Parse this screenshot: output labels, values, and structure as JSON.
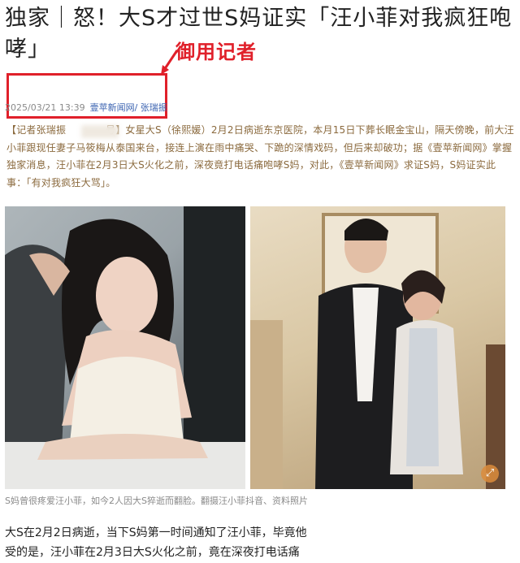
{
  "headline": "独家｜怒！大S才过世S妈证实「汪小菲对我疯狂咆哮」",
  "annotation": {
    "label": "御用记者",
    "color": "#e0202a"
  },
  "meta": {
    "date": "2025/03/21 13:39",
    "source": "壹苹新闻网/ 张瑞振"
  },
  "lead": "【记者张瑞振　　　　号】女星大S（徐熙媛）2月2日病逝东京医院，本月15日下葬长眠金宝山，隔天傍晚，前大汪小菲跟现任妻子马筱梅从泰国来台，接连上演在雨中痛哭、下跪的深情戏码，但后来却破功；据《壹苹新闻网》掌握独家消息，汪小菲在2月3日大S火化之前，深夜竟打电话痛咆哮S妈，对此，《壹苹新闻网》求证S妈，S妈证实此事：「有对我疯狂大骂」。",
  "caption": "S妈曾很疼爱汪小菲，如今2人因大S猝逝而翻脸。翻摄汪小菲抖音、资料照片",
  "body": {
    "line1": "大S在2月2日病逝，当下S妈第一时间通知了汪小菲，毕竟他",
    "line2": "受的是，汪小菲在2月3日大S火化之前，竟在深夜打电话痛"
  },
  "icons": {
    "expand": "expand-arrows-icon",
    "arrow": "red-arrow-icon"
  }
}
